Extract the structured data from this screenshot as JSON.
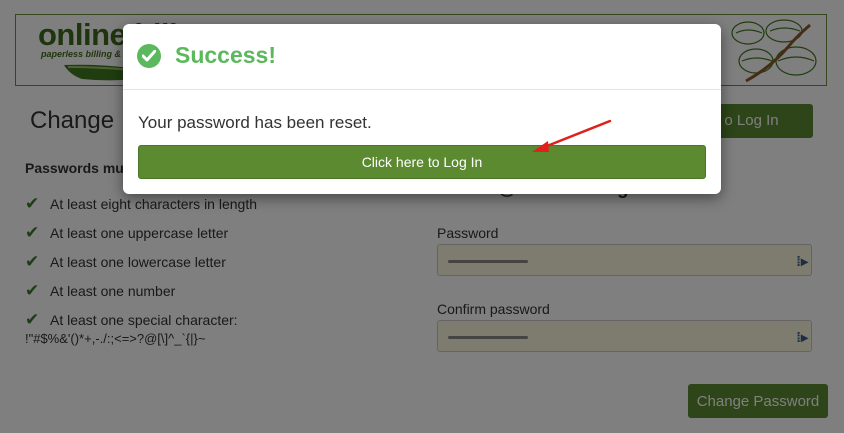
{
  "header": {
    "logo_text": "online bill",
    "logo_tagline": "paperless billing & "
  },
  "page": {
    "title": "Change",
    "login_button": "o Log In",
    "requirements_heading": "Passwords mu",
    "requirements": [
      "At least eight characters in length",
      "At least one uppercase letter",
      "At least one lowercase letter",
      "At least one number",
      "At least one special character:"
    ],
    "special_characters": "!\"#$%&'()*+,-./:;<=>?@[\\]^_`{|}~",
    "email": "lloonle@bonamailing.com",
    "password_label": "Password",
    "confirm_label": "Confirm password",
    "change_button": "Change Password"
  },
  "modal": {
    "title": "Success!",
    "message": "Your password has been reset.",
    "button": "Click here to Log In"
  },
  "colors": {
    "accent_green": "#5b8a31",
    "success_green": "#5cb85c",
    "arrow_red": "#e0201b"
  }
}
